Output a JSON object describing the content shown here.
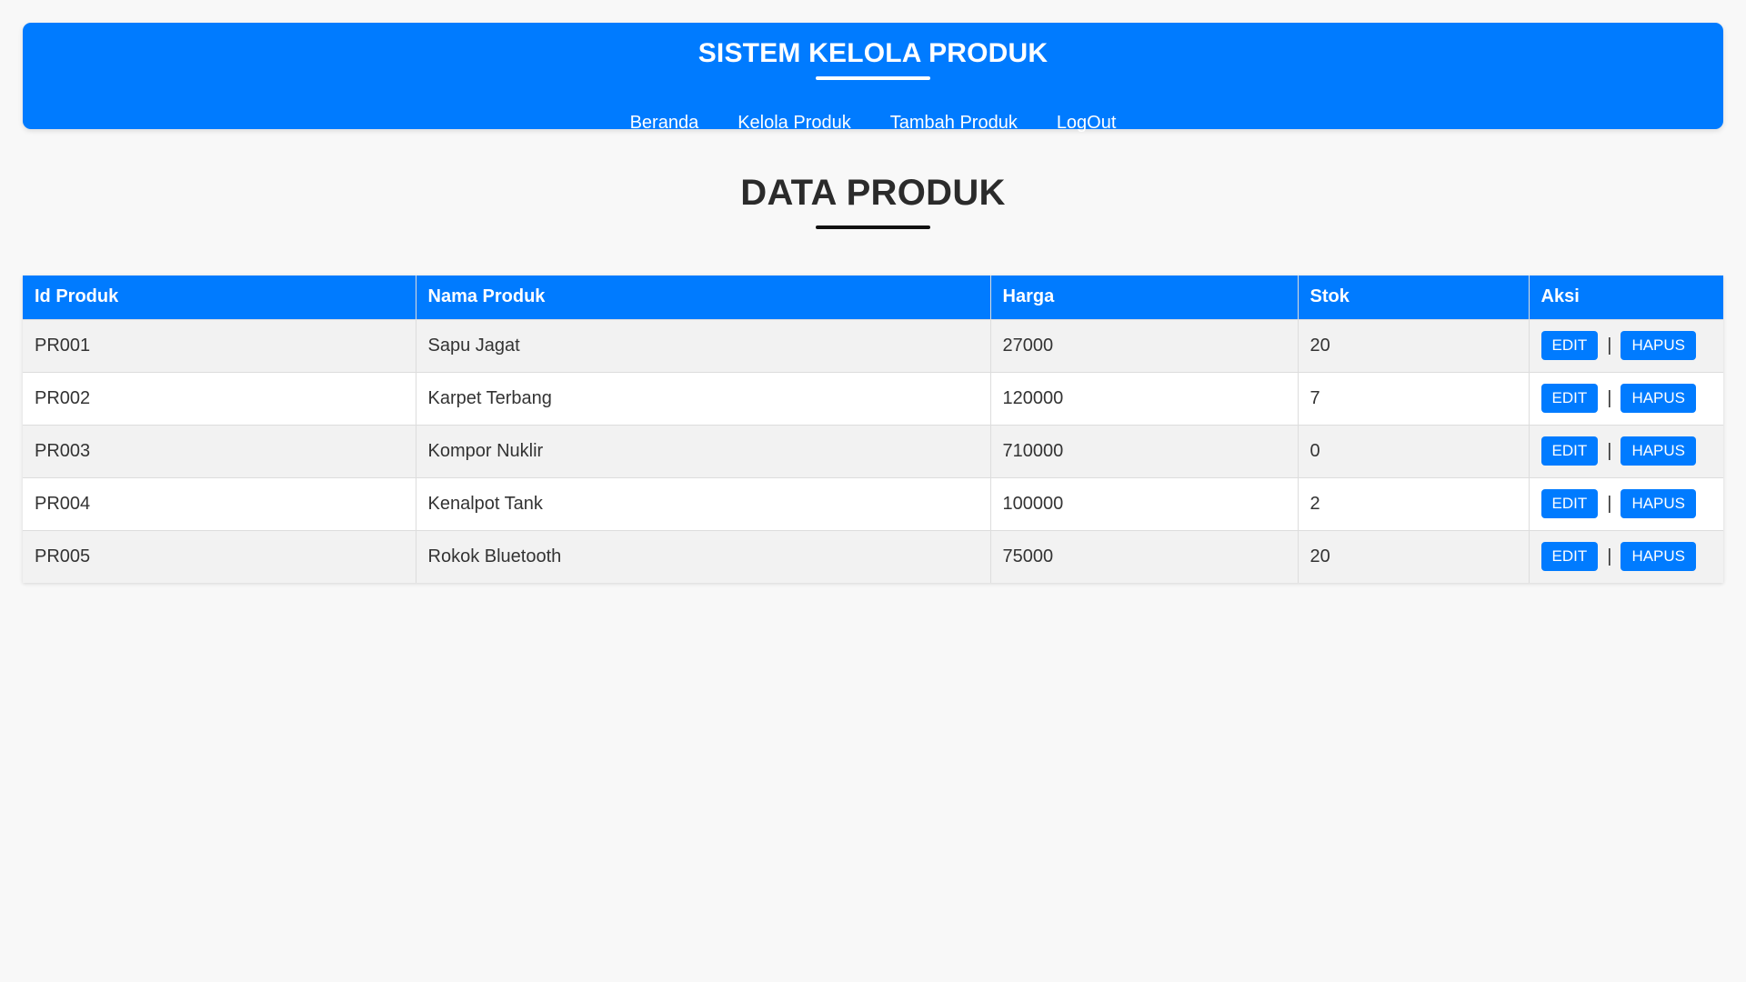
{
  "header": {
    "title": "SISTEM KELOLA PRODUK",
    "nav": [
      "Beranda",
      "Kelola Produk",
      "Tambah Produk",
      "LogOut"
    ]
  },
  "page_title": "DATA PRODUK",
  "table": {
    "columns": [
      "Id Produk",
      "Nama Produk",
      "Harga",
      "Stok",
      "Aksi"
    ],
    "rows": [
      {
        "id": "PR001",
        "name": "Sapu Jagat",
        "price": "27000",
        "stock": "20"
      },
      {
        "id": "PR002",
        "name": "Karpet Terbang",
        "price": "120000",
        "stock": "7"
      },
      {
        "id": "PR003",
        "name": "Kompor Nuklir",
        "price": "710000",
        "stock": "0"
      },
      {
        "id": "PR004",
        "name": "Kenalpot Tank",
        "price": "100000",
        "stock": "2"
      },
      {
        "id": "PR005",
        "name": "Rokok Bluetooth",
        "price": "75000",
        "stock": "20"
      }
    ],
    "edit_label": "EDIT",
    "delete_label": "HAPUS",
    "separator": "|"
  },
  "colors": {
    "primary": "#007bff",
    "background": "#f8f8f8",
    "row_alt": "#f2f2f2",
    "text": "#333333"
  }
}
